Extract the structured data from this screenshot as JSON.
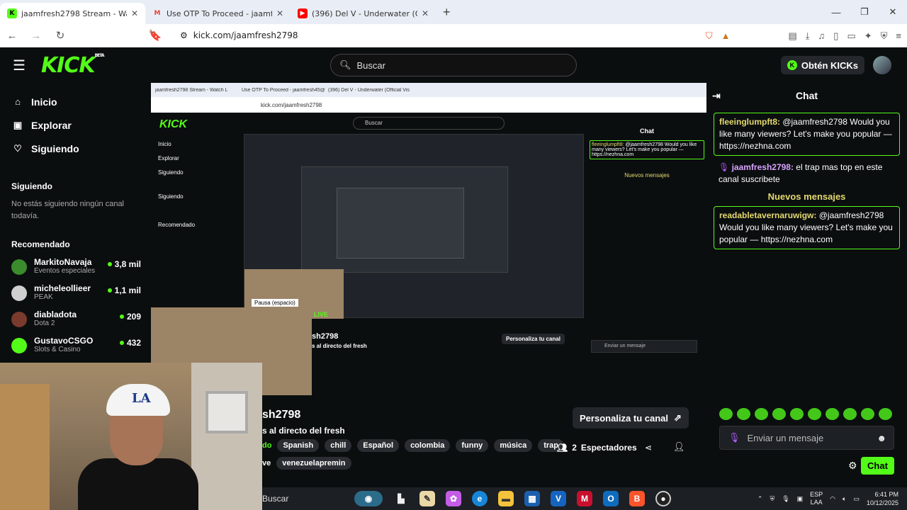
{
  "browser": {
    "tabs": [
      {
        "title": "jaamfresh2798 Stream - Watch L",
        "icon": "kick-icon",
        "color": "#53fc18",
        "active": true
      },
      {
        "title": "Use OTP To Proceed - jaamfresh45@",
        "icon": "gmail-icon",
        "color": "#ea4335",
        "active": false
      },
      {
        "title": "(396) Del V - Underwater (Official Vis",
        "icon": "youtube-icon",
        "color": "#ff0000",
        "active": false
      }
    ],
    "url": "kick.com/jaamfresh2798"
  },
  "header": {
    "logo": "KICK",
    "logo_badge": "BETA",
    "search_placeholder": "Buscar",
    "kicks_label": "Obtén KICKs"
  },
  "sidebar": {
    "nav": [
      {
        "label": "Inicio",
        "icon": "home-icon",
        "glyph": "⌂"
      },
      {
        "label": "Explorar",
        "icon": "explore-icon",
        "glyph": "▣"
      },
      {
        "label": "Siguiendo",
        "icon": "heart-icon",
        "glyph": "♡"
      }
    ],
    "following_heading": "Siguiendo",
    "following_empty": "No estás siguiendo ningún canal todavía.",
    "recommended_heading": "Recomendado",
    "recommended": [
      {
        "name": "MarkitoNavaja",
        "category": "Eventos especiales",
        "viewers": "3,8 mil",
        "color": "#3b8c2c"
      },
      {
        "name": "micheleollieer",
        "category": "PEAK",
        "viewers": "1,1 mil",
        "color": "#cfcfcf"
      },
      {
        "name": "diabladota",
        "category": "Dota 2",
        "viewers": "209",
        "color": "#7a3b2e"
      },
      {
        "name": "GustavoCSGO",
        "category": "Slots & Casino",
        "viewers": "432",
        "color": "#53fc18"
      }
    ]
  },
  "stream": {
    "nested_url": "kick.com/jaamfresh2798",
    "nested_tabs": [
      "jaamfresh2798 Stream - Watch L",
      "Use OTP To Proceed - jaamfresh45@",
      "(396) Del V - Underwater (Official Vis"
    ],
    "pause_label": "Pausa (espacio)",
    "live_label": "LIVE"
  },
  "channel": {
    "name": "sh2798",
    "title": "s al directo del fresh",
    "category": "do",
    "tags": [
      "Spanish",
      "chill",
      "Español",
      "colombia",
      "funny",
      "música",
      "trap"
    ],
    "tags2_prefix": "ve",
    "tags2": [
      "venezuelapremin"
    ],
    "personalize_label": "Personaliza tu canal",
    "viewers_count": "2",
    "viewers_label": "Espectadores"
  },
  "chat": {
    "title": "Chat",
    "messages": [
      {
        "user": "fleeinglumpft8:",
        "text": " @jaamfresh2798 Would you like many viewers? Let's make you popular — https://nezhna.com",
        "highlight": true
      },
      {
        "user": "jaamfresh2798:",
        "text": " el trap mas top en este canal suscribete",
        "highlight": false
      }
    ],
    "new_messages_label": "Nuevos mensajes",
    "messages_after": [
      {
        "user": "readabletavernaruwigw:",
        "text": " @jaamfresh2798 Would you like many viewers? Let's make you popular — https://nezhna.com",
        "highlight": true
      }
    ],
    "input_placeholder": "Enviar un mensaje",
    "send_label": "Chat"
  },
  "taskbar": {
    "search": "Buscar",
    "lang": "ESP",
    "lang2": "LAA",
    "time": "6:41 PM",
    "date": "10/12/2025"
  }
}
